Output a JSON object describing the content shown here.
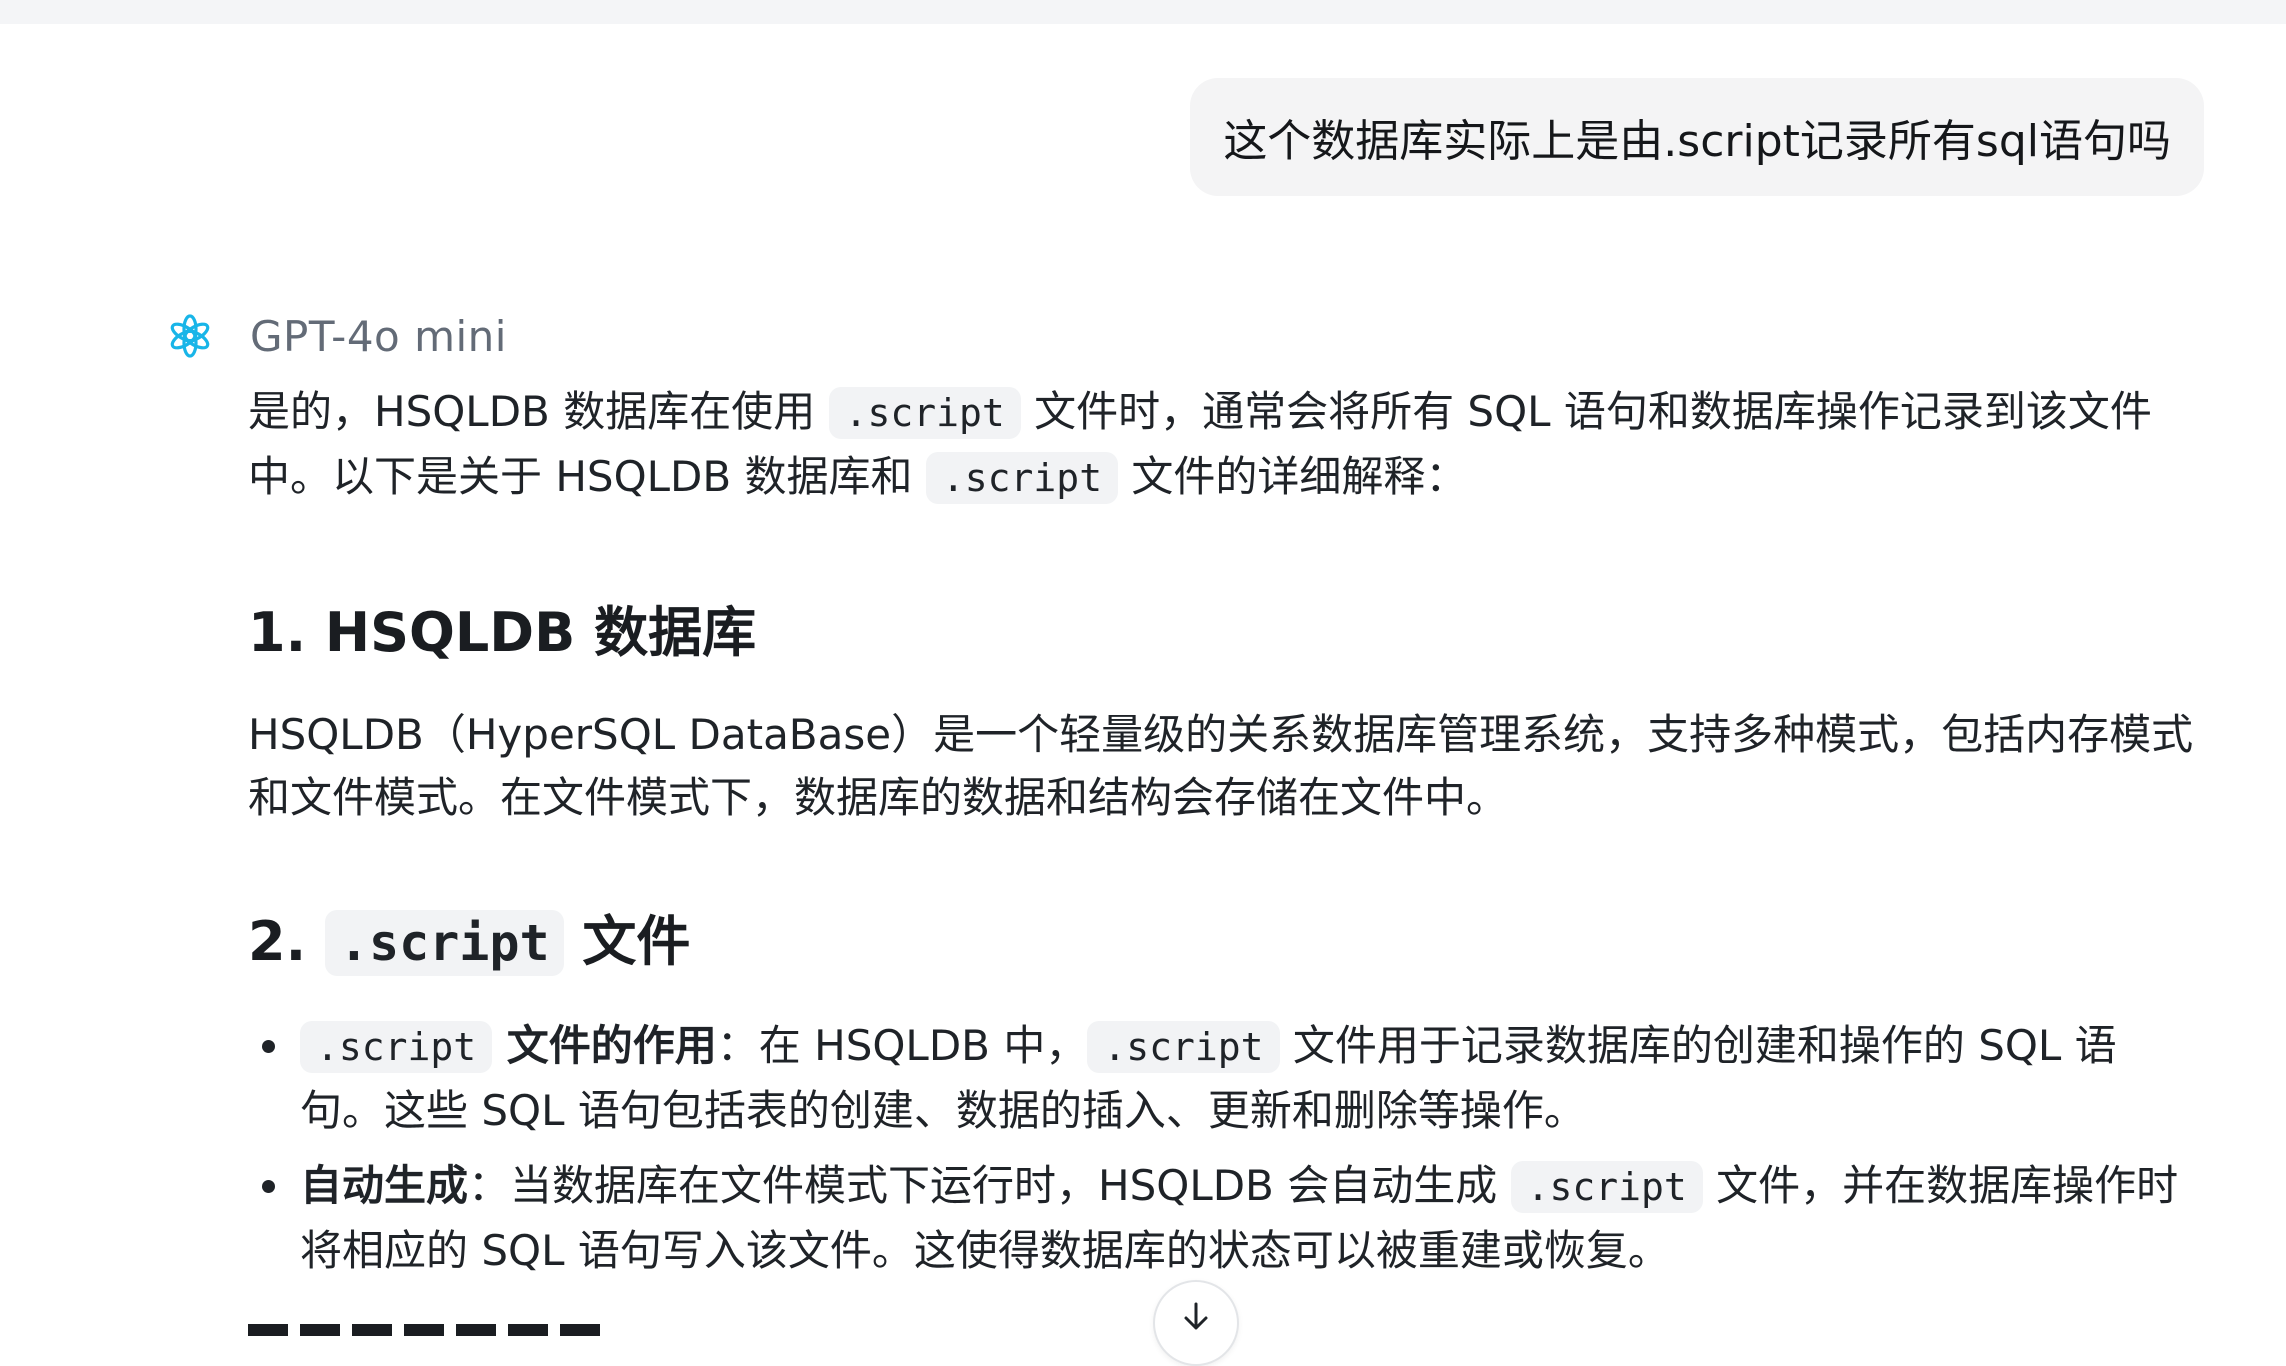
{
  "user_message": {
    "text": "这个数据库实际上是由.script记录所有sql语句吗"
  },
  "assistant": {
    "model_name": "GPT-4o mini",
    "intro": {
      "t1": "是的，HSQLDB 数据库在使用 ",
      "c1": ".script",
      "t2": " 文件时，通常会将所有 SQL 语句和数据库操作记录到该文件中。以下是关于 HSQLDB 数据库和 ",
      "c2": ".script",
      "t3": " 文件的详细解释："
    },
    "section1": {
      "heading": "1. HSQLDB 数据库",
      "body": "HSQLDB（HyperSQL DataBase）是一个轻量级的关系数据库管理系统，支持多种模式，包括内存模式和文件模式。在文件模式下，数据库的数据和结构会存储在文件中。"
    },
    "section2": {
      "heading_prefix": "2. ",
      "heading_code": ".script",
      "heading_suffix": " 文件",
      "bullets": [
        {
          "code": ".script",
          "bold": " 文件的作用",
          "t1": "：在 HSQLDB 中，",
          "code2": ".script",
          "t2": " 文件用于记录数据库的创建和操作的 SQL 语句。这些 SQL 语句包括表的创建、数据的插入、更新和删除等操作。"
        },
        {
          "bold": "自动生成",
          "t1": "：当数据库在文件模式下运行时，HSQLDB 会自动生成 ",
          "code": ".script",
          "t2": " 文件，并在数据库操作时将相应的 SQL 语句写入该文件。这使得数据库的状态可以被重建或恢复。"
        }
      ]
    }
  },
  "colors": {
    "user_bubble": "#f4f4f5",
    "avatar_accent": "#18b5e8",
    "code_bg": "#f2f3f5",
    "model_name": "#636b77"
  },
  "icons": {
    "avatar": "openai-logo-icon",
    "scroll": "arrow-down-icon"
  }
}
